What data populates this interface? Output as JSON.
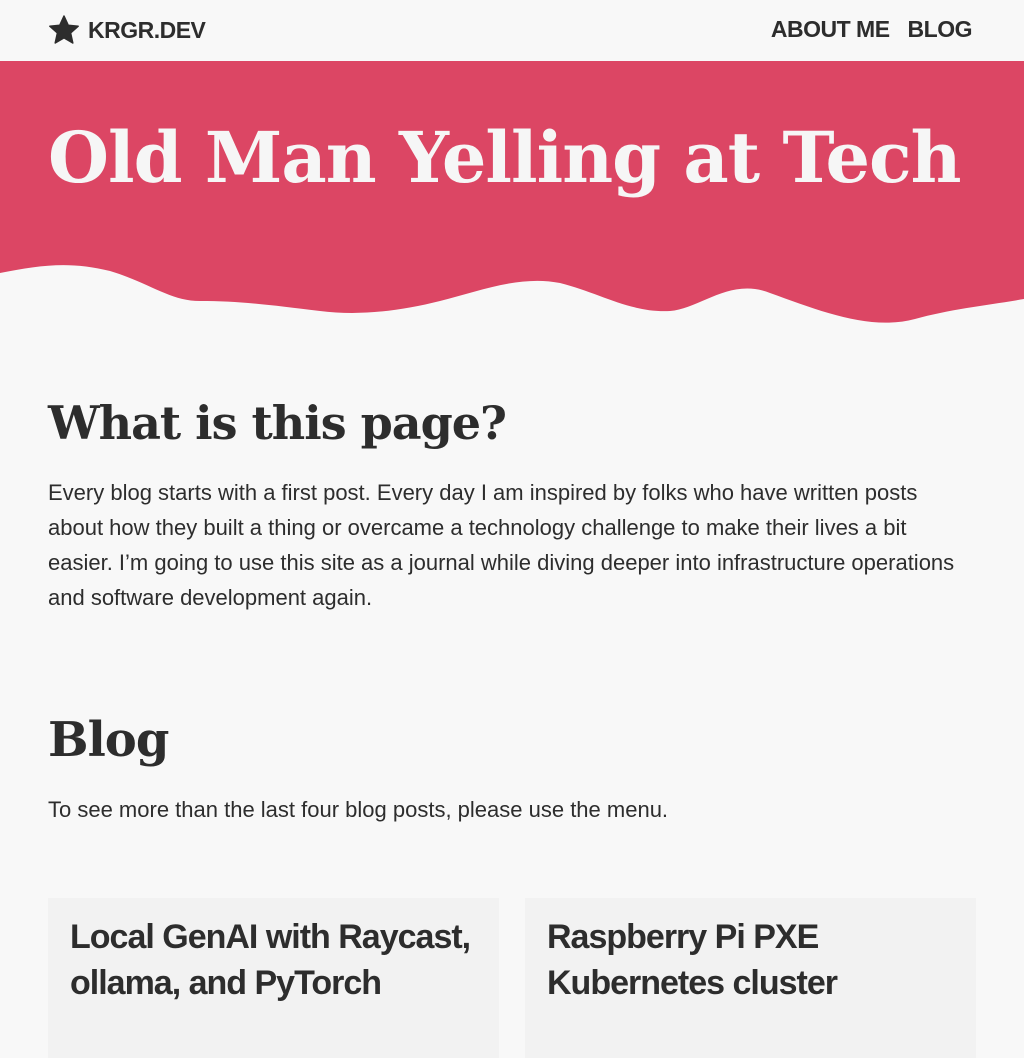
{
  "header": {
    "brand": {
      "icon": "star-icon",
      "name": "KRGR.DEV"
    },
    "nav": [
      {
        "label": "ABOUT ME"
      },
      {
        "label": "BLOG"
      }
    ]
  },
  "hero": {
    "title": "Old Man Yelling at Tech"
  },
  "about": {
    "heading": "What is this page?",
    "body": "Every blog starts with a first post. Every day I am inspired by folks who have written posts about how they built a thing or overcame a technology challenge to make their lives a bit easier. I’m going to use this site as a journal while diving deeper into infrastructure operations and software development again."
  },
  "blog": {
    "heading": "Blog",
    "intro": "To see more than the last four blog posts, please use the menu.",
    "posts": [
      {
        "title": "Local GenAI with Raycast, ollama, and PyTorch"
      },
      {
        "title": "Raspberry Pi PXE Kubernetes cluster"
      }
    ]
  },
  "colors": {
    "accent": "#dc4664",
    "background": "#f8f8f8",
    "text": "#2d2d2d",
    "hero_text": "#f6f6f6"
  }
}
